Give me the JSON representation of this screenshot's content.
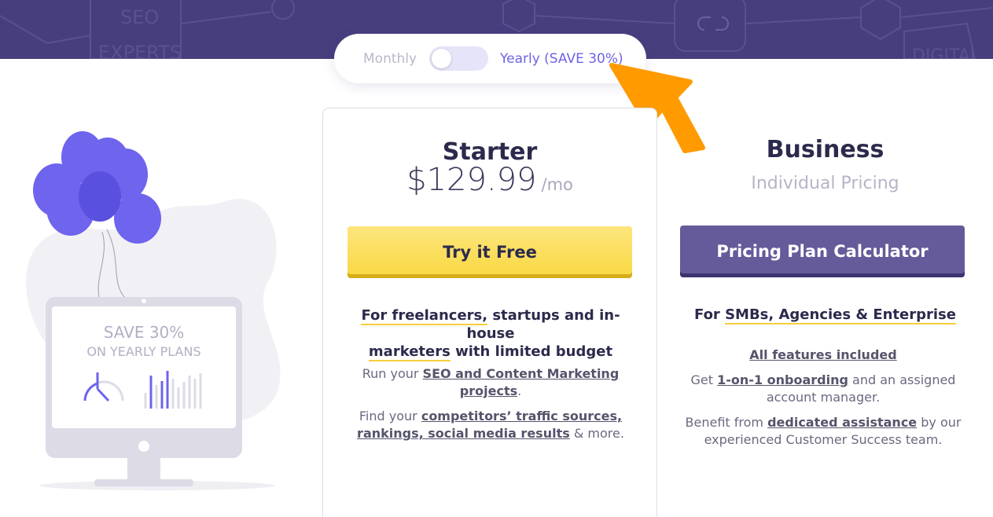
{
  "billing_toggle": {
    "monthly_label": "Monthly",
    "yearly_label": "Yearly (SAVE 30%)",
    "state": "monthly"
  },
  "hero": {
    "background_words": [
      "SEO",
      "EXPERTS",
      "DIGITAL"
    ]
  },
  "promo": {
    "line1": "SAVE 30%",
    "line2": "ON YEARLY PLANS"
  },
  "plans": {
    "starter": {
      "title": "Starter",
      "price": "$129.99",
      "period": "/mo",
      "cta_label": "Try it Free",
      "audience_hl1": "For freelancers,",
      "audience_mid": " startups and in-house",
      "audience_hl2": "marketers",
      "audience_end": " with limited budget",
      "desc1_pre": "Run your ",
      "desc1_link": "SEO and Content Marketing projects",
      "desc1_post": ".",
      "desc2_pre": "Find your ",
      "desc2_link": "competitors’ traffic sources, rankings, social media results",
      "desc2_post": " & more."
    },
    "business": {
      "title": "Business",
      "subtitle": "Individual Pricing",
      "cta_label": "Pricing Plan Calculator",
      "audience_pre": "For ",
      "audience_hl": "SMBs, Agencies & Enterprise",
      "features_link": "All features included",
      "desc1_pre": "Get ",
      "desc1_link": "1-on-1 onboarding",
      "desc1_post": " and an assigned account manager.",
      "desc2_pre": "Benefit from ",
      "desc2_link": "dedicated assistance",
      "desc2_post": " by our experienced Customer Success team."
    }
  },
  "colors": {
    "band": "#473e7e",
    "accent_purple": "#6c63e6",
    "cta_yellow": "#f9d840",
    "cta_purple": "#655b9a",
    "arrow_orange": "#ff9a00"
  }
}
